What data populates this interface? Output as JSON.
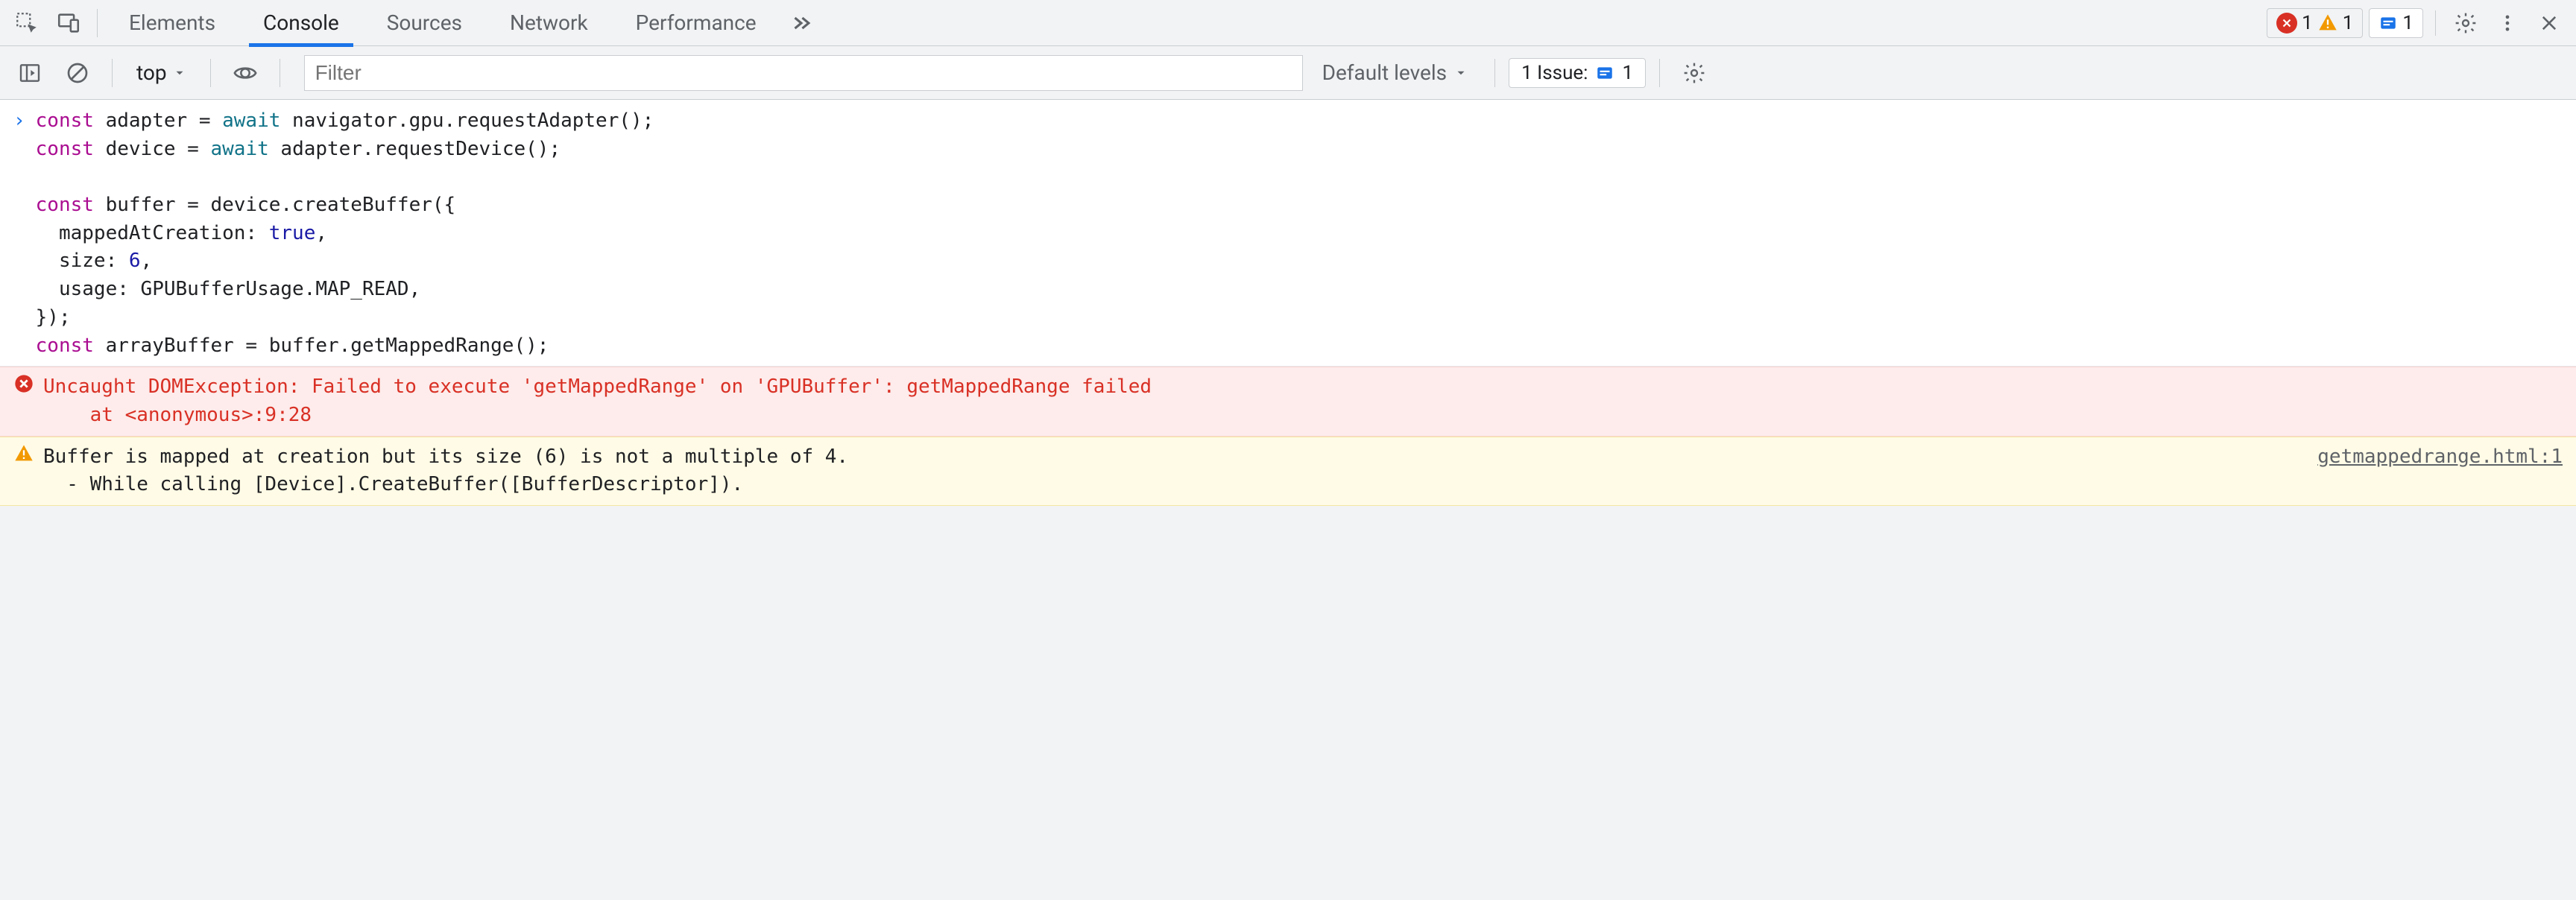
{
  "tabs": {
    "elements": "Elements",
    "console": "Console",
    "sources": "Sources",
    "network": "Network",
    "performance": "Performance"
  },
  "active_tab": "Console",
  "counts": {
    "errors": "1",
    "warnings": "1",
    "info": "1"
  },
  "console_toolbar": {
    "context": "top",
    "filter_placeholder": "Filter",
    "levels": "Default levels",
    "issue_label": "1 Issue:",
    "issue_count": "1"
  },
  "code": {
    "l1a": "const",
    "l1b": " adapter = ",
    "l1c": "await",
    "l1d": " navigator.gpu.requestAdapter();",
    "l2a": "const",
    "l2b": " device = ",
    "l2c": "await",
    "l2d": " adapter.requestDevice();",
    "l3": "",
    "l4a": "const",
    "l4b": " buffer = device.createBuffer({",
    "l5a": "  mappedAtCreation: ",
    "l5b": "true",
    "l5c": ",",
    "l6a": "  size: ",
    "l6b": "6",
    "l6c": ",",
    "l7": "  usage: GPUBufferUsage.MAP_READ,",
    "l8": "});",
    "l9a": "const",
    "l9b": " arrayBuffer = buffer.getMappedRange();"
  },
  "error": {
    "line1": "Uncaught DOMException: Failed to execute 'getMappedRange' on 'GPUBuffer': getMappedRange failed",
    "line2": "    at <anonymous>:9:28"
  },
  "warning": {
    "line1": "Buffer is mapped at creation but its size (6) is not a multiple of 4.",
    "line2": "  - While calling [Device].CreateBuffer([BufferDescriptor]).",
    "source": "getmappedrange.html:1"
  }
}
